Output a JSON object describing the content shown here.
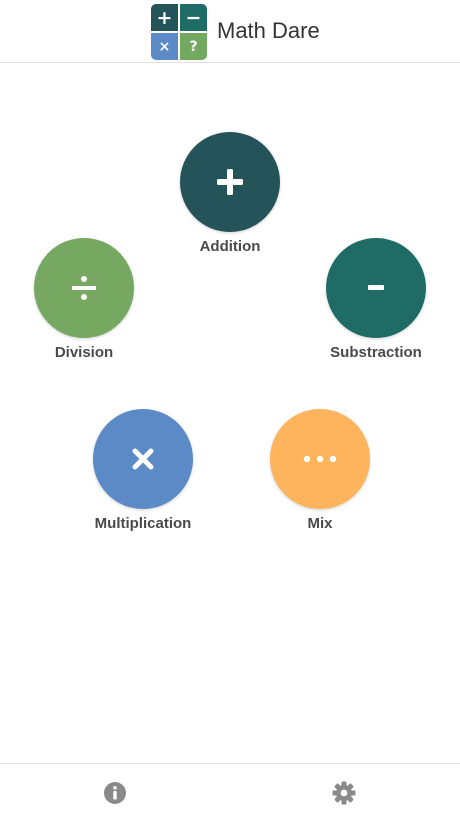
{
  "header": {
    "title": "Math Dare",
    "logo": {
      "cells": [
        "+",
        "−",
        "×",
        "?"
      ]
    }
  },
  "operations": {
    "addition": {
      "label": "Addition",
      "icon": "plus-icon",
      "color": "#25535a"
    },
    "division": {
      "label": "Division",
      "icon": "divide-icon",
      "color": "#77a862"
    },
    "substraction": {
      "label": "Substraction",
      "icon": "minus-icon",
      "color": "#1f6b66"
    },
    "multiplication": {
      "label": "Multiplication",
      "icon": "times-icon",
      "color": "#5b8ac6"
    },
    "mix": {
      "label": "Mix",
      "icon": "ellipsis-icon",
      "color": "#fdb45c"
    }
  },
  "footer": {
    "info_icon": "info-icon",
    "settings_icon": "gear-icon",
    "icon_color": "#8a8a8a"
  }
}
